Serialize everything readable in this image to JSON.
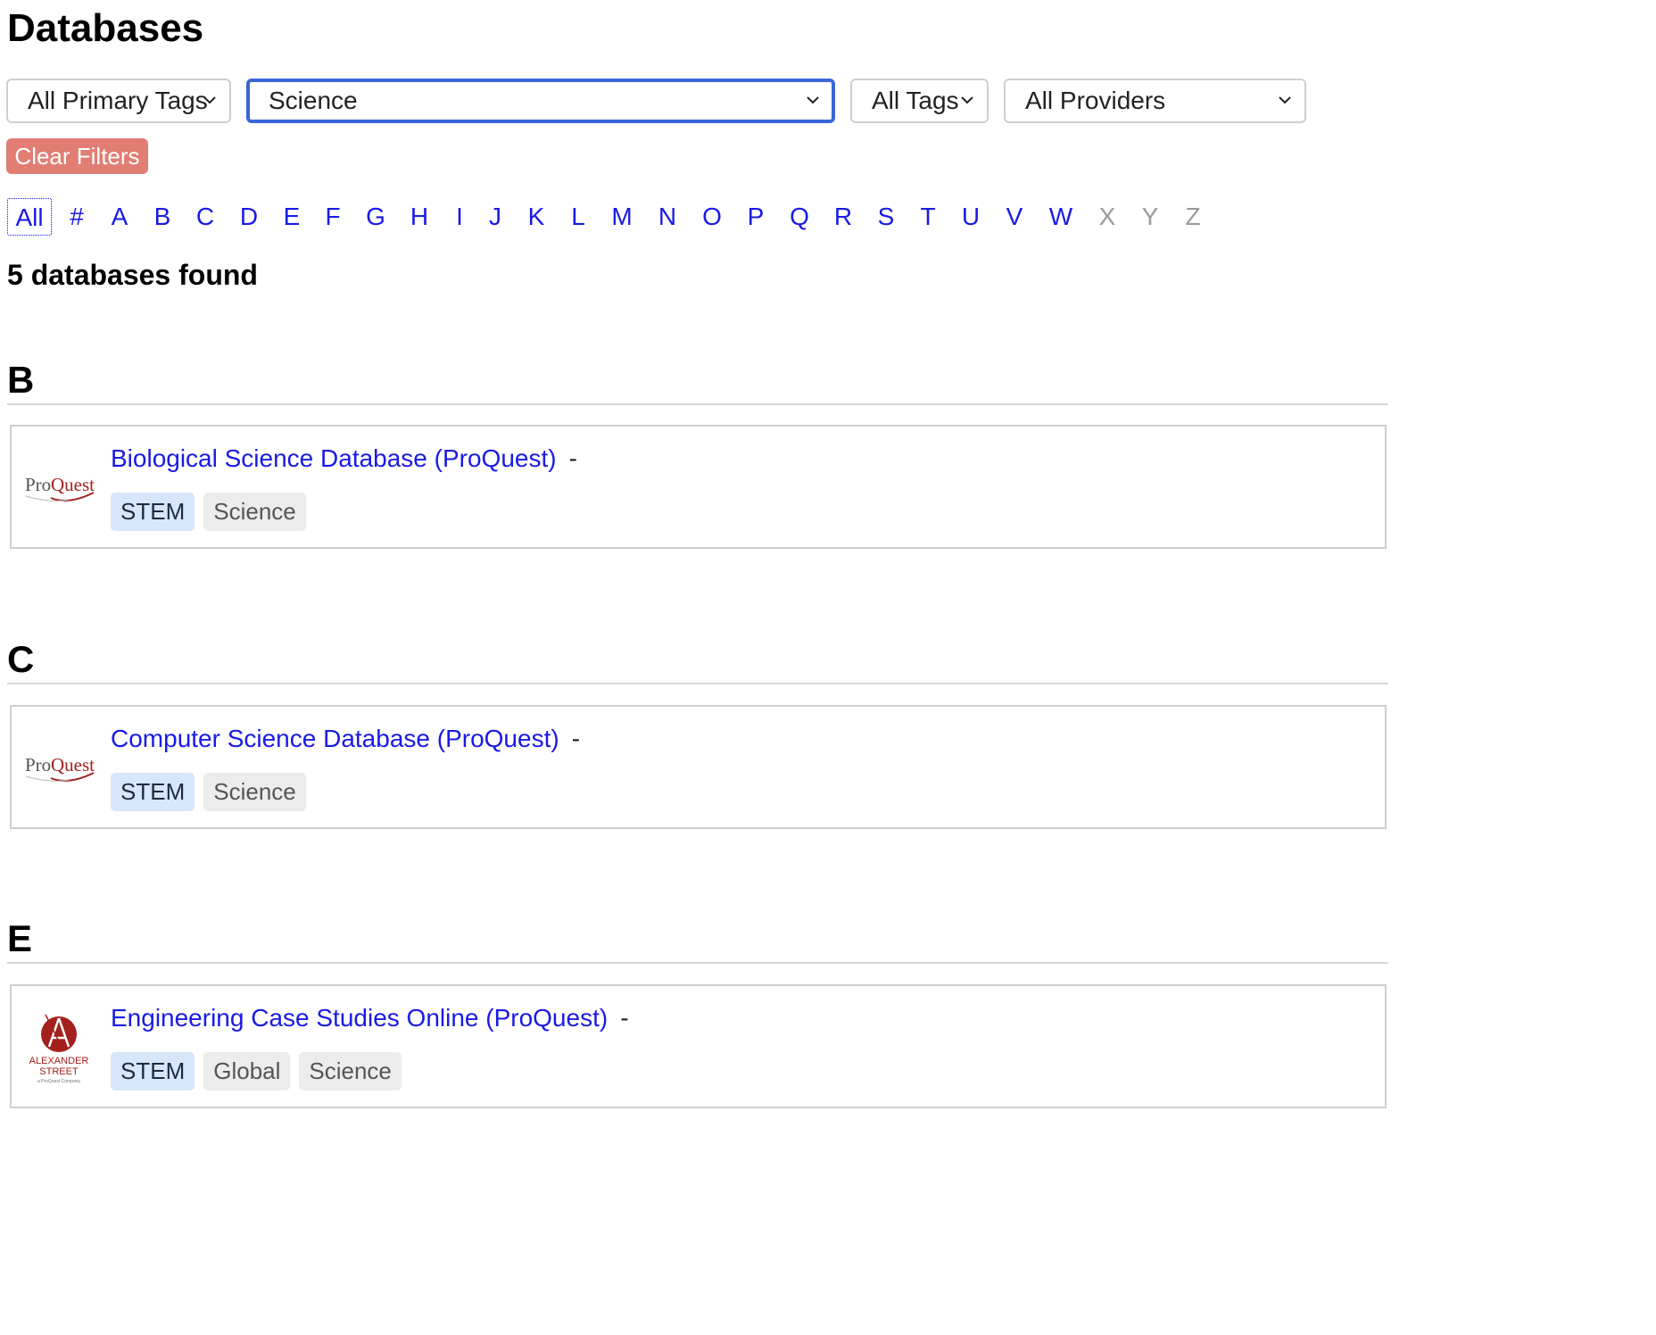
{
  "page": {
    "title": "Databases"
  },
  "filters": {
    "primary_tags": {
      "selected": "All Primary Tags"
    },
    "subject": {
      "selected": "Science"
    },
    "tags": {
      "selected": "All Tags"
    },
    "providers": {
      "selected": "All Providers"
    },
    "clear_label": "Clear Filters"
  },
  "alphabet": {
    "letters": [
      {
        "label": "All",
        "state": "current"
      },
      {
        "label": "#",
        "state": "enabled"
      },
      {
        "label": "A",
        "state": "enabled"
      },
      {
        "label": "B",
        "state": "enabled"
      },
      {
        "label": "C",
        "state": "enabled"
      },
      {
        "label": "D",
        "state": "enabled"
      },
      {
        "label": "E",
        "state": "enabled"
      },
      {
        "label": "F",
        "state": "enabled"
      },
      {
        "label": "G",
        "state": "enabled"
      },
      {
        "label": "H",
        "state": "enabled"
      },
      {
        "label": "I",
        "state": "enabled"
      },
      {
        "label": "J",
        "state": "enabled"
      },
      {
        "label": "K",
        "state": "enabled"
      },
      {
        "label": "L",
        "state": "enabled"
      },
      {
        "label": "M",
        "state": "enabled"
      },
      {
        "label": "N",
        "state": "enabled"
      },
      {
        "label": "O",
        "state": "enabled"
      },
      {
        "label": "P",
        "state": "enabled"
      },
      {
        "label": "Q",
        "state": "enabled"
      },
      {
        "label": "R",
        "state": "enabled"
      },
      {
        "label": "S",
        "state": "enabled"
      },
      {
        "label": "T",
        "state": "enabled"
      },
      {
        "label": "U",
        "state": "enabled"
      },
      {
        "label": "V",
        "state": "enabled"
      },
      {
        "label": "W",
        "state": "enabled"
      },
      {
        "label": "X",
        "state": "disabled"
      },
      {
        "label": "Y",
        "state": "disabled"
      },
      {
        "label": "Z",
        "state": "disabled"
      }
    ]
  },
  "results": {
    "count_text": "5 databases found"
  },
  "sections": [
    {
      "letter": "B",
      "databases": [
        {
          "title": "Biological Science Database (ProQuest)",
          "suffix": "-",
          "logo": "proquest-logo",
          "tags": [
            {
              "label": "STEM",
              "kind": "primary"
            },
            {
              "label": "Science",
              "kind": "secondary"
            }
          ]
        }
      ]
    },
    {
      "letter": "C",
      "databases": [
        {
          "title": "Computer Science Database (ProQuest)",
          "suffix": "-",
          "logo": "proquest-logo",
          "tags": [
            {
              "label": "STEM",
              "kind": "primary"
            },
            {
              "label": "Science",
              "kind": "secondary"
            }
          ]
        }
      ]
    },
    {
      "letter": "E",
      "databases": [
        {
          "title": "Engineering Case Studies Online (ProQuest)",
          "suffix": "-",
          "logo": "alexander-street-logo",
          "tags": [
            {
              "label": "STEM",
              "kind": "primary"
            },
            {
              "label": "Global",
              "kind": "secondary"
            },
            {
              "label": "Science",
              "kind": "secondary"
            }
          ]
        }
      ]
    }
  ],
  "logos": {
    "proquest": {
      "text_pro": "Pro",
      "text_quest": "Quest"
    },
    "alexander_street": {
      "line1": "ALEXANDER",
      "line2": "STREET",
      "line3": "a ProQuest Company"
    }
  },
  "colors": {
    "link": "#1a1ae6",
    "clear_button": "#e27d74",
    "focus_border": "#3a66d6",
    "primary_tag_bg": "#d6e6fb",
    "secondary_tag_bg": "#ececec",
    "brand_red": "#a3201c"
  }
}
